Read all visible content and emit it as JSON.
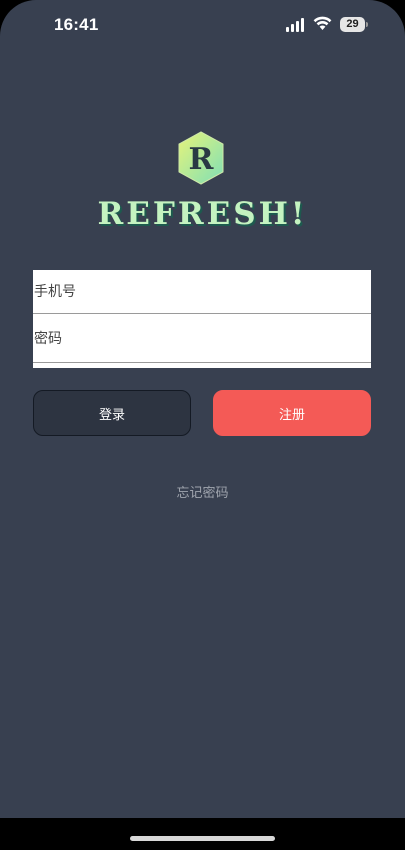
{
  "status_bar": {
    "time": "16:41",
    "battery_level": "29",
    "icons": [
      "signal-icon",
      "wifi-icon",
      "battery-icon"
    ]
  },
  "brand": {
    "logo_letter": "R",
    "title": "REFRESH!",
    "title_color": "#c4f3c0",
    "badge_gradient": [
      "#e7f47a",
      "#7fdfb6"
    ]
  },
  "form": {
    "phone_placeholder": "手机号",
    "phone_value": "",
    "password_placeholder": "密码",
    "password_value": ""
  },
  "actions": {
    "login_label": "登录",
    "register_label": "注册",
    "forgot_label": "忘记密码"
  },
  "colors": {
    "background": "#384050",
    "register_accent": "#f45a56",
    "login_button": "#2d3441"
  }
}
